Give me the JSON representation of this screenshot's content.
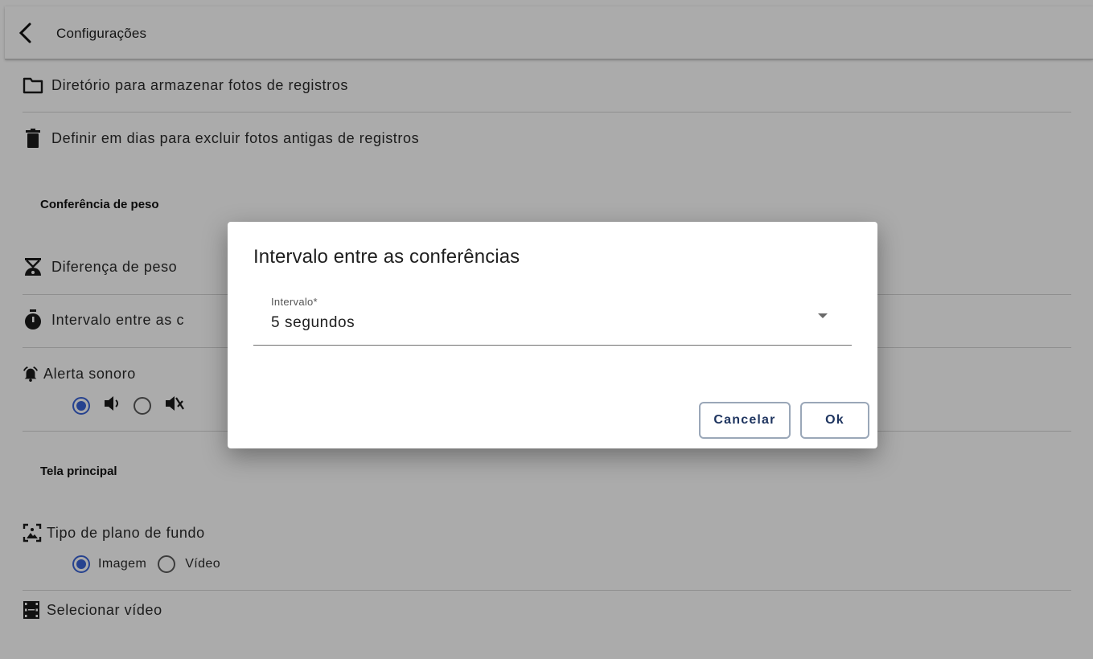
{
  "app": {
    "title": "Configurações"
  },
  "settings": {
    "photo_directory": "Diretório para armazenar fotos de registros",
    "delete_old_photos": "Definir em dias para excluir fotos antigas de registros",
    "weight_section_title": "Conferência de peso",
    "weight_difference": "Diferença de peso",
    "interval_partial": "Intervalo entre as c",
    "sound_alert": "Alerta sonoro",
    "sound_options": [
      {
        "icon": "volume-on-icon",
        "selected": true
      },
      {
        "icon": "volume-off-icon",
        "selected": false
      }
    ],
    "main_screen_section_title": "Tela principal",
    "background_type": "Tipo de plano de fundo",
    "background_options": [
      {
        "label": "Imagem",
        "selected": true
      },
      {
        "label": "Vídeo",
        "selected": false
      }
    ],
    "select_video": "Selecionar vídeo"
  },
  "dialog": {
    "title": "Intervalo entre as conferências",
    "field_label": "Intervalo*",
    "field_value": "5 segundos",
    "cancel_label": "Cancelar",
    "ok_label": "Ok"
  },
  "colors": {
    "accent": "#3a63d6",
    "button_text": "#1f3560",
    "scrim": "rgba(0,0,0,0.33)"
  }
}
